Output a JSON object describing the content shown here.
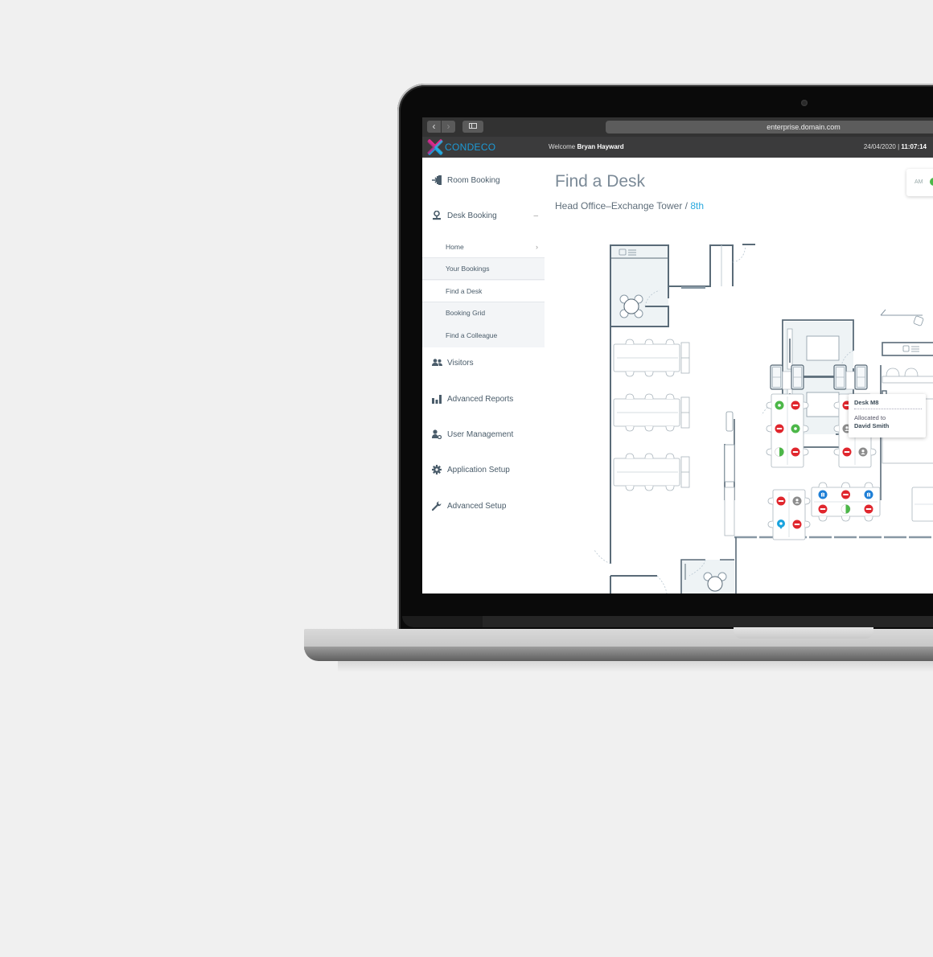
{
  "browser": {
    "url": "enterprise.domain.com",
    "back_icon": "chevron-left-icon",
    "forward_icon": "chevron-right-icon",
    "sidebar_icon": "sidebar-toggle-icon"
  },
  "appbar": {
    "logo_text": "CONDECO",
    "welcome_prefix": "Welcome",
    "user_name": "Bryan Hayward",
    "date": "24/04/2020",
    "separator": "|",
    "time": "11:07:14"
  },
  "sidebar": {
    "items": [
      {
        "label": "Room Booking",
        "icon": "room-booking-icon"
      },
      {
        "label": "Desk Booking",
        "icon": "desk-booking-icon",
        "expanded_indicator": "–"
      },
      {
        "label": "Visitors",
        "icon": "visitors-icon"
      },
      {
        "label": "Advanced Reports",
        "icon": "bar-chart-icon"
      },
      {
        "label": "User Management",
        "icon": "user-gear-icon"
      },
      {
        "label": "Application Setup",
        "icon": "gear-icon"
      },
      {
        "label": "Advanced Setup",
        "icon": "wrench-icon"
      }
    ],
    "submenu": [
      {
        "label": "Home",
        "chevron": "›"
      },
      {
        "label": "Your Bookings"
      },
      {
        "label": "Find a Desk"
      },
      {
        "label": "Booking Grid"
      },
      {
        "label": "Find a Colleague"
      }
    ]
  },
  "main": {
    "title": "Find a Desk",
    "location": "Head Office–Exchange Tower / ",
    "floor": "8th",
    "ampm_label": "AM",
    "tooltip": {
      "desk": "Desk M8",
      "allocated_label": "Allocated to",
      "person": "David Smith"
    }
  },
  "colors": {
    "brand_blue": "#1c9ad6",
    "floor_accent": "#29a8de",
    "booked_red": "#e0262d",
    "available_green": "#4cb748",
    "allocated_grey": "#8d8d8d",
    "visitor_blue": "#1e7fd6",
    "wall": "#5a6b78"
  },
  "desks": {
    "cluster_a": [
      "available",
      "booked",
      "booked",
      "available",
      "partial",
      "booked"
    ],
    "cluster_b": [
      "booked",
      "allocated",
      "allocated",
      "booked",
      "booked",
      "allocated"
    ],
    "cluster_c": [
      "booked",
      "allocated",
      "location",
      "booked"
    ],
    "cluster_d": [
      "visitor",
      "booked",
      "visitor",
      "booked",
      "partial",
      "booked"
    ]
  }
}
